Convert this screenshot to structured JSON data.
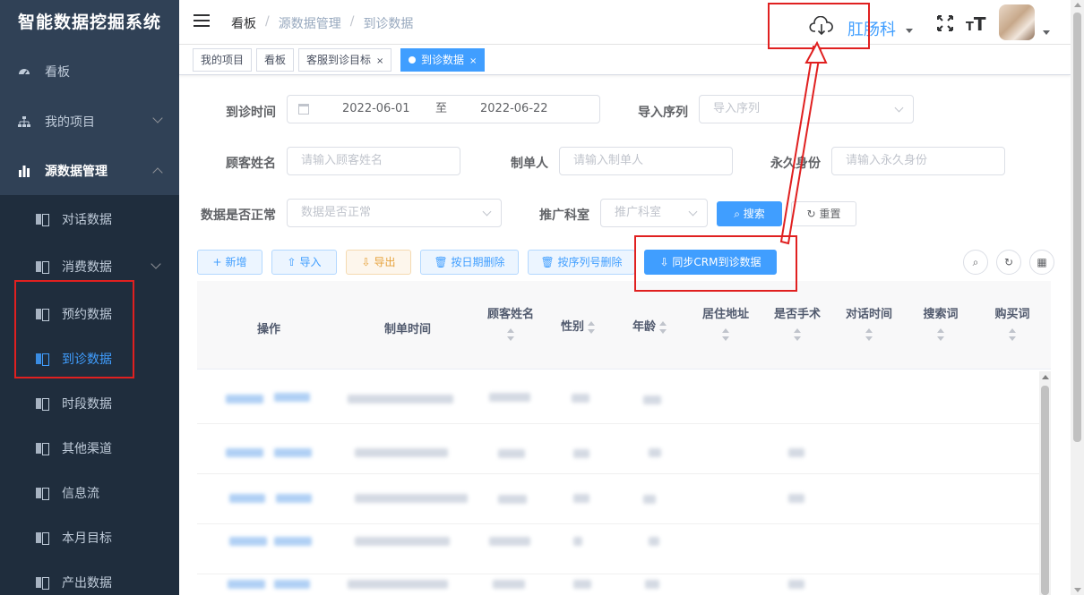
{
  "app": {
    "title": "智能数据挖掘系统"
  },
  "sidebar": {
    "items": [
      {
        "label": "看板",
        "icon": "dashboard-icon"
      },
      {
        "label": "我的项目",
        "icon": "tree-icon"
      },
      {
        "label": "源数据管理",
        "icon": "bar-chart-icon"
      }
    ],
    "submenu": [
      {
        "label": "对话数据"
      },
      {
        "label": "消费数据"
      },
      {
        "label": "预约数据"
      },
      {
        "label": "到诊数据"
      },
      {
        "label": "时段数据"
      },
      {
        "label": "其他渠道"
      },
      {
        "label": "信息流"
      },
      {
        "label": "本月目标"
      },
      {
        "label": "产出数据"
      }
    ],
    "active_item": "到诊数据"
  },
  "navbar": {
    "breadcrumb": [
      "看板",
      "源数据管理",
      "到诊数据"
    ],
    "separator": "/",
    "department": "肛肠科",
    "textsize_glyph": "T"
  },
  "tags": [
    {
      "label": "我的项目"
    },
    {
      "label": "看板"
    },
    {
      "label": "客服到诊目标",
      "close": "×"
    },
    {
      "label": "到诊数据",
      "close": "×"
    }
  ],
  "form": {
    "visit_time": {
      "label": "到诊时间",
      "start": "2022-06-01",
      "sep": "至",
      "end": "2022-06-22"
    },
    "import_seq": {
      "label": "导入序列",
      "placeholder": "导入序列"
    },
    "customer_name": {
      "label": "顾客姓名",
      "placeholder": "请输入顾客姓名"
    },
    "creator": {
      "label": "制单人",
      "placeholder": "请输入制单人"
    },
    "permanent_id": {
      "label": "永久身份",
      "placeholder": "请输入永久身份"
    },
    "data_normal": {
      "label": "数据是否正常",
      "placeholder": "数据是否正常"
    },
    "promo_dept": {
      "label": "推广科室",
      "placeholder": "推广科室"
    },
    "search_label": "搜索",
    "reset_label": "重置"
  },
  "toolbar": {
    "add": "新增",
    "import": "导入",
    "export": "导出",
    "delete_by_date": "按日期删除",
    "delete_by_seq": "按序列号删除",
    "sync_crm": "同步CRM到诊数据"
  },
  "table": {
    "columns": [
      "操作",
      "制单时间",
      "顾客姓名",
      "性别",
      "年龄",
      "居住地址",
      "是否手术",
      "对话时间",
      "搜索词",
      "购买词"
    ]
  },
  "colors": {
    "accent": "#409eff",
    "sidebar": "#304156",
    "annotation": "#e02020"
  }
}
